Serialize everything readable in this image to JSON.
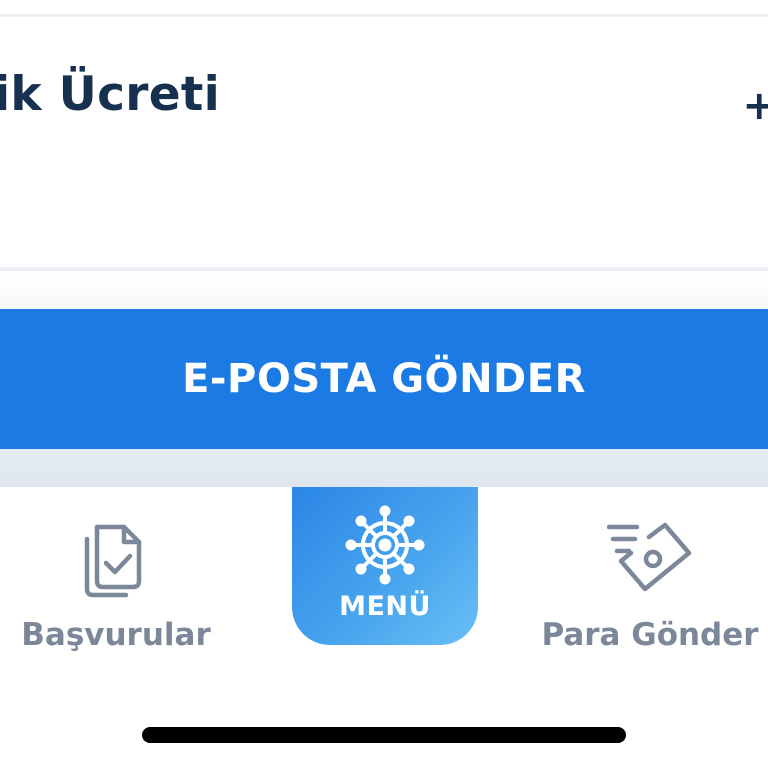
{
  "fee": {
    "label": "ik Ücreti",
    "amount": "+"
  },
  "actions": {
    "email_button_label": "E-POSTA GÖNDER"
  },
  "tab_bar": {
    "tabs": [
      {
        "label": "Başvurular",
        "icon": "documents-check-icon"
      },
      {
        "label": "MENÜ",
        "icon": "ship-wheel-icon"
      },
      {
        "label": "Para Gönder",
        "icon": "money-send-icon"
      }
    ]
  },
  "colors": {
    "primary": "#1b7ae4",
    "menu_gradient_start": "#2a86e6",
    "menu_gradient_end": "#69bff5",
    "heading_text": "#16304f",
    "tab_inactive": "#7c8899"
  }
}
